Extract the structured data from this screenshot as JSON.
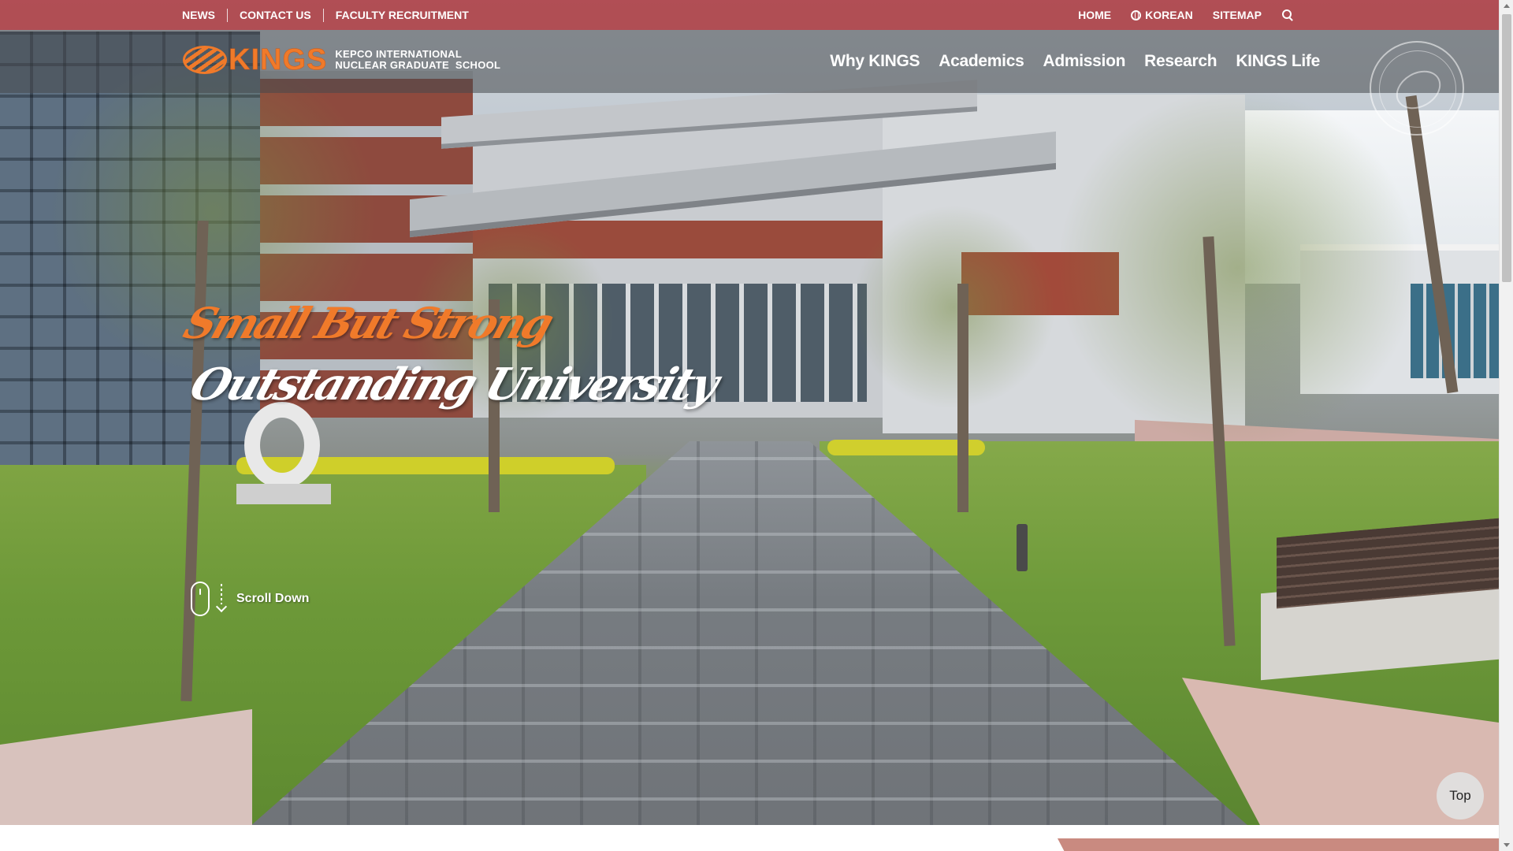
{
  "utility_bar": {
    "left_links": [
      "NEWS",
      "CONTACT US",
      "FACULTY RECRUITMENT"
    ],
    "home": "HOME",
    "korean": "KOREAN",
    "sitemap": "SITEMAP",
    "background_color": "#a8282e"
  },
  "header": {
    "logo_word": "KINGS",
    "logo_line1": "KEPCO INTERNATIONAL",
    "logo_line2": "NUCLEAR GRADUATE  SCHOOL",
    "nav": [
      "Why KINGS",
      "Academics",
      "Admission",
      "Research",
      "KINGS Life"
    ],
    "accent_color": "#f07a2a"
  },
  "hero": {
    "slogan_line1": "Small But Strong",
    "slogan_line2": "Outstanding University",
    "scroll_label": "Scroll Down"
  },
  "top_button": "Top"
}
